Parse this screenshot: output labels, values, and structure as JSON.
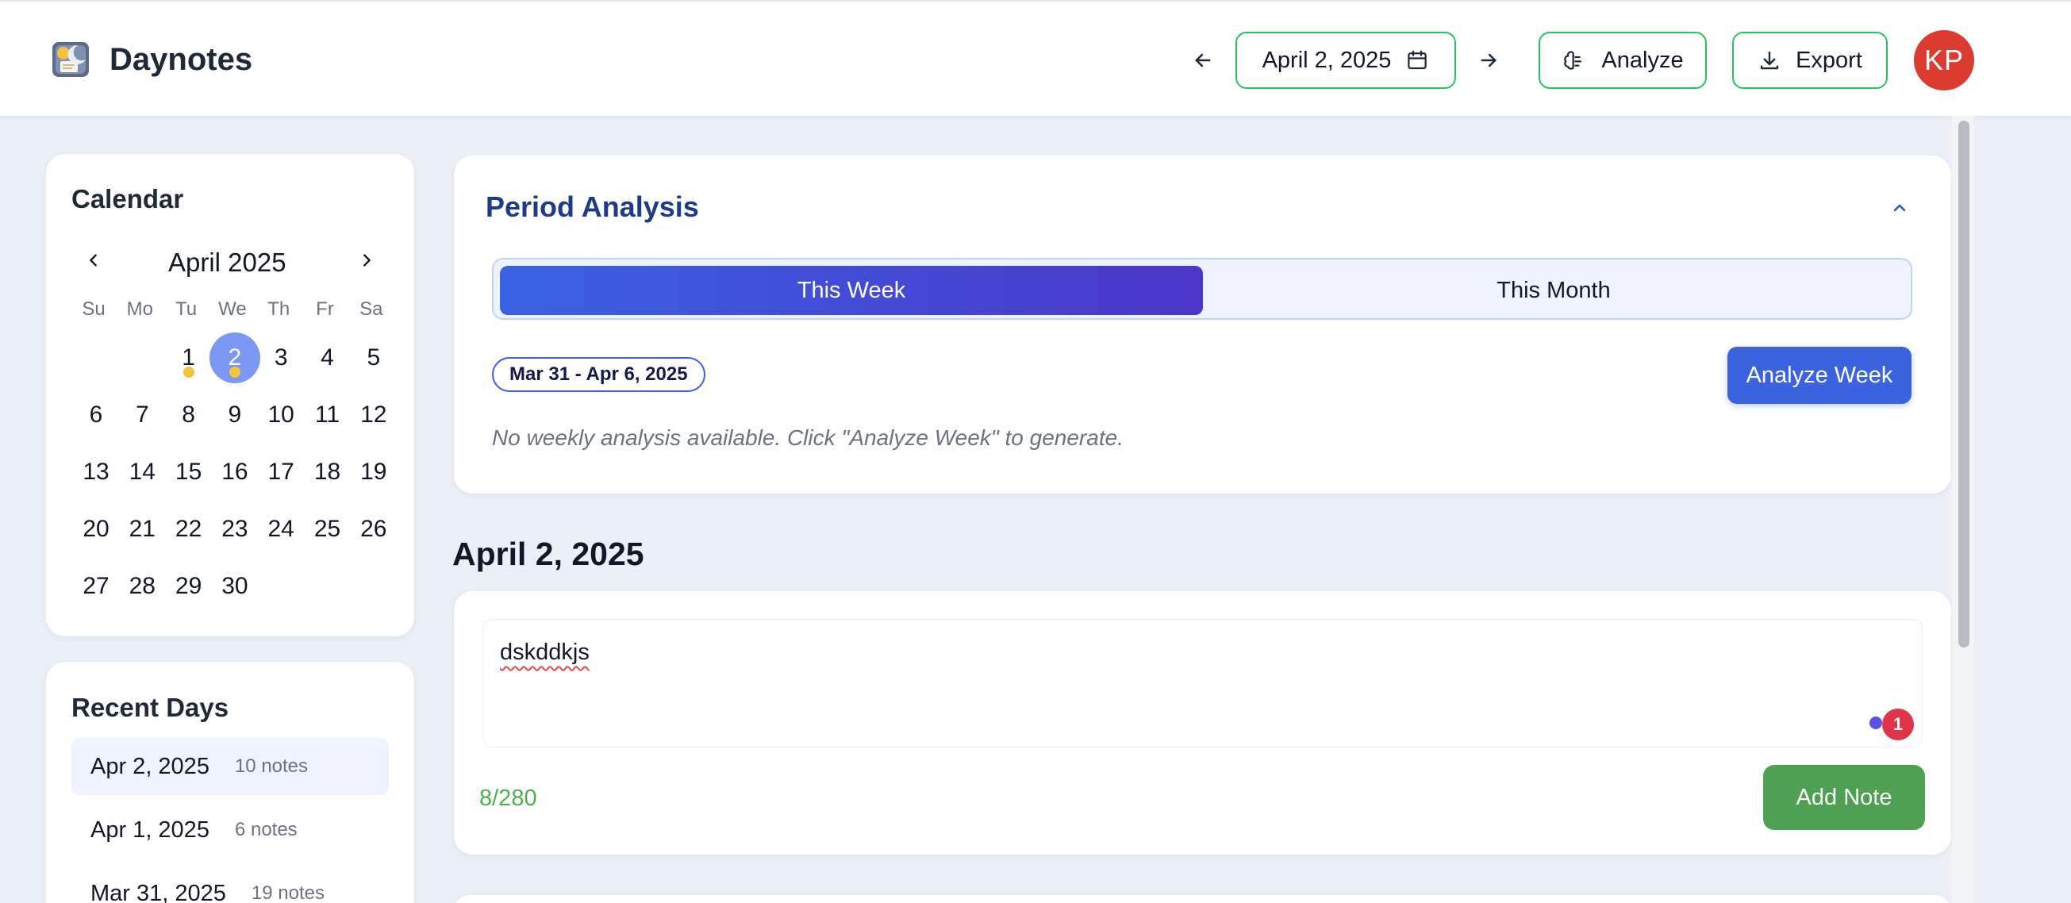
{
  "app": {
    "title": "Daynotes"
  },
  "header": {
    "current_date": "April 2, 2025",
    "analyze_label": "Analyze",
    "export_label": "Export",
    "avatar_initials": "KP"
  },
  "calendar": {
    "heading": "Calendar",
    "month_label": "April 2025",
    "weekdays": [
      "Su",
      "Mo",
      "Tu",
      "We",
      "Th",
      "Fr",
      "Sa"
    ],
    "first_weekday_index": 2,
    "days_in_month": 30,
    "selected_day": 2,
    "days_with_notes": [
      1,
      2
    ]
  },
  "recent_days": {
    "heading": "Recent Days",
    "items": [
      {
        "date": "Apr 2, 2025",
        "count": "10 notes",
        "active": true
      },
      {
        "date": "Apr 1, 2025",
        "count": "6 notes",
        "active": false
      },
      {
        "date": "Mar 31, 2025",
        "count": "19 notes",
        "active": false
      }
    ]
  },
  "period_analysis": {
    "title": "Period Analysis",
    "tabs": [
      {
        "label": "This Week",
        "active": true
      },
      {
        "label": "This Month",
        "active": false
      }
    ],
    "range_label": "Mar 31 - Apr 6, 2025",
    "analyze_button": "Analyze Week",
    "empty_message": "No weekly analysis available. Click \"Analyze Week\" to generate."
  },
  "day": {
    "title": "April 2, 2025",
    "note_input_value": "dskddkjs",
    "char_count": "8/280",
    "add_note_label": "Add Note",
    "extension_badge_count": "1"
  },
  "colors": {
    "accent_blue": "#3b63e0",
    "accent_green": "#22c55e",
    "add_note_green": "#4ea152",
    "avatar_red": "#dc3b30",
    "selected_day": "#7b98f5",
    "note_dot": "#f2c53d"
  }
}
